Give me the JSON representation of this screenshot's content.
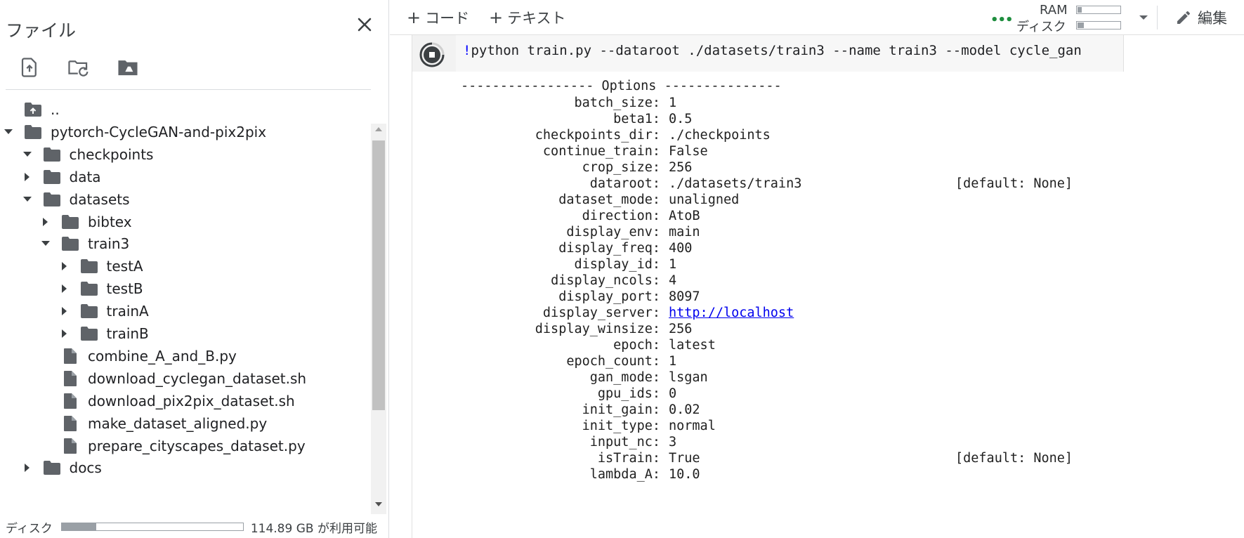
{
  "file_panel": {
    "title": "ファイル",
    "toolbar": [
      {
        "name": "upload-file-icon"
      },
      {
        "name": "refresh-folder-icon"
      },
      {
        "name": "mount-drive-icon"
      }
    ],
    "tree": [
      {
        "label": "..",
        "type": "parent",
        "depth": 0,
        "expand": "none"
      },
      {
        "label": "pytorch-CycleGAN-and-pix2pix",
        "type": "folder",
        "depth": 0,
        "expand": "open"
      },
      {
        "label": "checkpoints",
        "type": "folder",
        "depth": 1,
        "expand": "open"
      },
      {
        "label": "data",
        "type": "folder",
        "depth": 1,
        "expand": "closed"
      },
      {
        "label": "datasets",
        "type": "folder",
        "depth": 1,
        "expand": "open"
      },
      {
        "label": "bibtex",
        "type": "folder",
        "depth": 2,
        "expand": "closed"
      },
      {
        "label": "train3",
        "type": "folder",
        "depth": 2,
        "expand": "open"
      },
      {
        "label": "testA",
        "type": "folder",
        "depth": 3,
        "expand": "closed"
      },
      {
        "label": "testB",
        "type": "folder",
        "depth": 3,
        "expand": "closed"
      },
      {
        "label": "trainA",
        "type": "folder",
        "depth": 3,
        "expand": "closed"
      },
      {
        "label": "trainB",
        "type": "folder",
        "depth": 3,
        "expand": "closed"
      },
      {
        "label": "combine_A_and_B.py",
        "type": "file",
        "depth": 2,
        "expand": "none"
      },
      {
        "label": "download_cyclegan_dataset.sh",
        "type": "file",
        "depth": 2,
        "expand": "none"
      },
      {
        "label": "download_pix2pix_dataset.sh",
        "type": "file",
        "depth": 2,
        "expand": "none"
      },
      {
        "label": "make_dataset_aligned.py",
        "type": "file",
        "depth": 2,
        "expand": "none"
      },
      {
        "label": "prepare_cityscapes_dataset.py",
        "type": "file",
        "depth": 2,
        "expand": "none"
      },
      {
        "label": "docs",
        "type": "folder",
        "depth": 1,
        "expand": "closed"
      }
    ],
    "disk": {
      "label": "ディスク",
      "used_fraction": 0.19,
      "free_text": "114.89 GB が利用可能"
    }
  },
  "toolbar": {
    "add_code": "コード",
    "add_text": "テキスト",
    "ram_label": "RAM",
    "disk_label": "ディスク",
    "ram_fraction": 0.1,
    "disk_fraction": 0.15,
    "edit_label": "編集"
  },
  "cell": {
    "code_prefix": "!",
    "code_text": "python train.py --dataroot ./datasets/train3 --name train3 --model cycle_gan",
    "output_header": "----------------- Options ---------------",
    "options": [
      {
        "key": "batch_size:",
        "value": "1",
        "default": ""
      },
      {
        "key": "beta1:",
        "value": "0.5",
        "default": ""
      },
      {
        "key": "checkpoints_dir:",
        "value": "./checkpoints",
        "default": ""
      },
      {
        "key": "continue_train:",
        "value": "False",
        "default": ""
      },
      {
        "key": "crop_size:",
        "value": "256",
        "default": ""
      },
      {
        "key": "dataroot:",
        "value": "./datasets/train3",
        "default": "[default: None]"
      },
      {
        "key": "dataset_mode:",
        "value": "unaligned",
        "default": ""
      },
      {
        "key": "direction:",
        "value": "AtoB",
        "default": ""
      },
      {
        "key": "display_env:",
        "value": "main",
        "default": ""
      },
      {
        "key": "display_freq:",
        "value": "400",
        "default": ""
      },
      {
        "key": "display_id:",
        "value": "1",
        "default": ""
      },
      {
        "key": "display_ncols:",
        "value": "4",
        "default": ""
      },
      {
        "key": "display_port:",
        "value": "8097",
        "default": ""
      },
      {
        "key": "display_server:",
        "value": "http://localhost",
        "default": "",
        "link": true
      },
      {
        "key": "display_winsize:",
        "value": "256",
        "default": ""
      },
      {
        "key": "epoch:",
        "value": "latest",
        "default": ""
      },
      {
        "key": "epoch_count:",
        "value": "1",
        "default": ""
      },
      {
        "key": "gan_mode:",
        "value": "lsgan",
        "default": ""
      },
      {
        "key": "gpu_ids:",
        "value": "0",
        "default": ""
      },
      {
        "key": "init_gain:",
        "value": "0.02",
        "default": ""
      },
      {
        "key": "init_type:",
        "value": "normal",
        "default": ""
      },
      {
        "key": "input_nc:",
        "value": "3",
        "default": ""
      },
      {
        "key": "isTrain:",
        "value": "True",
        "default": "[default: None]"
      },
      {
        "key": "lambda_A:",
        "value": "10.0",
        "default": ""
      }
    ]
  },
  "colors": {
    "connected": "#1e8e3e",
    "link": "#0000ee",
    "bang": "#0000ff"
  }
}
